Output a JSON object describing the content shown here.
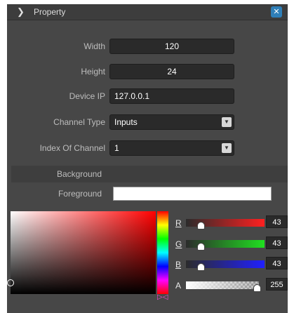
{
  "window": {
    "title": "Property",
    "close_label": "✕"
  },
  "fields": {
    "width": {
      "label": "Width",
      "value": "120"
    },
    "height": {
      "label": "Height",
      "value": "24"
    },
    "device_ip": {
      "label": "Device IP",
      "value": "127.0.0.1"
    },
    "channel_type": {
      "label": "Channel Type",
      "value": "Inputs"
    },
    "index_of_channel": {
      "label": "Index Of Channel",
      "value": "1"
    }
  },
  "colors": {
    "background_label": "Background",
    "foreground_label": "Foreground",
    "foreground_value": "#ffffff"
  },
  "picker": {
    "r": {
      "label": "R",
      "value": "43"
    },
    "g": {
      "label": "G",
      "value": "43"
    },
    "b": {
      "label": "B",
      "value": "43"
    },
    "a": {
      "label": "A",
      "value": "255"
    }
  },
  "icons": {
    "expand": "chevron-right-icon",
    "close": "close-icon",
    "dropdown": "chevron-down-icon"
  }
}
